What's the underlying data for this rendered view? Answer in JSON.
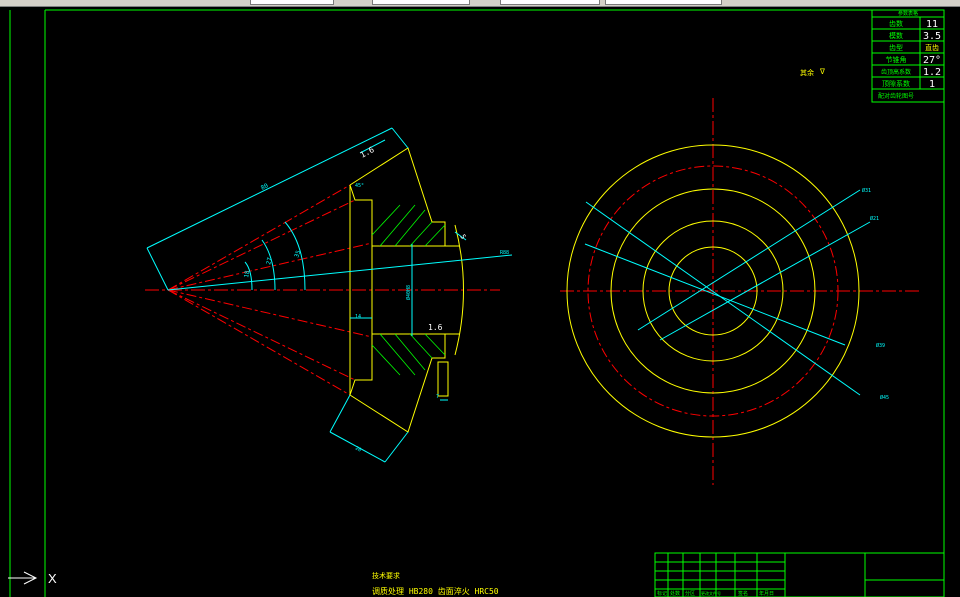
{
  "toolbar": {
    "fields": [
      "",
      "",
      "",
      ""
    ]
  },
  "param_table": {
    "header": "参数表格",
    "rows": [
      {
        "label": "齿数",
        "value": "11"
      },
      {
        "label": "模数",
        "value": "3.5"
      },
      {
        "label": "齿型",
        "value": "直齿"
      },
      {
        "label": "节锥角",
        "value": "27°"
      },
      {
        "label": "齿顶高系数",
        "value": "1.2"
      },
      {
        "label": "顶隙系数",
        "value": "1"
      },
      {
        "label": "配对齿轮图号",
        "value": ""
      }
    ]
  },
  "surface_note": "其余",
  "surface_symbol": "∇",
  "section_dims": {
    "length": "80",
    "angle1": "18",
    "angle2": "27",
    "angle3": "35",
    "thickness": "1.6",
    "chamfer": "45°",
    "r_label": "R88",
    "bore": "Ø40H8",
    "width": "14",
    "rough": "1.6",
    "key": "7",
    "face": "20",
    "groove": "5"
  },
  "circle_dims": {
    "d1": "Ø31",
    "d2": "Ø21",
    "d3": "Ø39",
    "d4": "Ø45"
  },
  "tech_req": {
    "title": "技术要求",
    "line1": "调质处理 HB280  齿面淬火 HRC50"
  },
  "title_block": {
    "headers": [
      "标记",
      "处数",
      "分区",
      "更改文件号",
      "签名",
      "年月日"
    ]
  },
  "ucs_label": "X",
  "colors": {
    "border": "#00ff00",
    "dimension": "#00ffff",
    "centerline": "#ff0000",
    "outline": "#ffff00",
    "hatch": "#00ff00",
    "text": "#ffff00"
  }
}
